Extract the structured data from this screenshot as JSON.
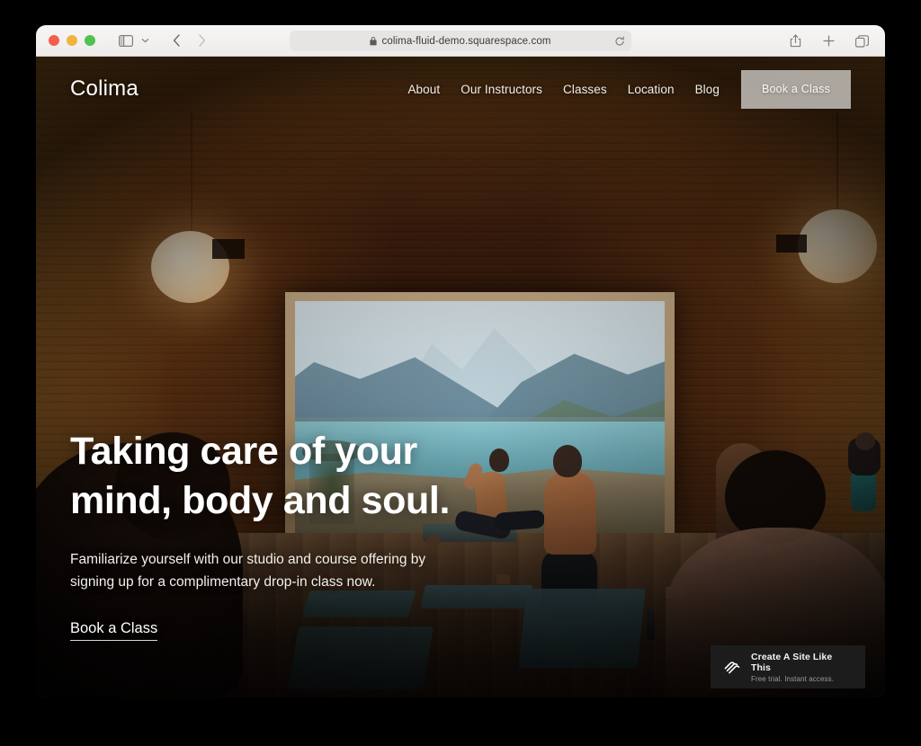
{
  "browser": {
    "url": "colima-fluid-demo.squarespace.com",
    "lock_icon": "lock-icon",
    "reload_icon": "reload-icon",
    "sidebar_icon": "sidebar-toggle-icon",
    "chevron_icon": "chevron-down-icon",
    "back_icon": "chevron-left-icon",
    "forward_icon": "chevron-right-icon",
    "share_icon": "share-icon",
    "new_tab_icon": "plus-icon",
    "tabs_icon": "tab-overview-icon",
    "traffic_lights": {
      "close": "#f2604c",
      "minimize": "#f2b33d",
      "maximize": "#4fc24f"
    }
  },
  "site": {
    "logo": "Colima",
    "nav_links": [
      {
        "label": "About"
      },
      {
        "label": "Our Instructors"
      },
      {
        "label": "Classes"
      },
      {
        "label": "Location"
      },
      {
        "label": "Blog"
      }
    ],
    "nav_button": "Book a Class",
    "hero": {
      "heading": "Taking care of your mind, body and soul.",
      "subtext": "Familiarize yourself with our studio and course offering by signing up for a complimentary drop-in class now.",
      "cta": "Book a Class"
    }
  },
  "badge": {
    "title": "Create A Site Like This",
    "subtitle": "Free trial. Instant access.",
    "logo_icon": "squarespace-logo-icon",
    "background": "#1c1c1c"
  }
}
